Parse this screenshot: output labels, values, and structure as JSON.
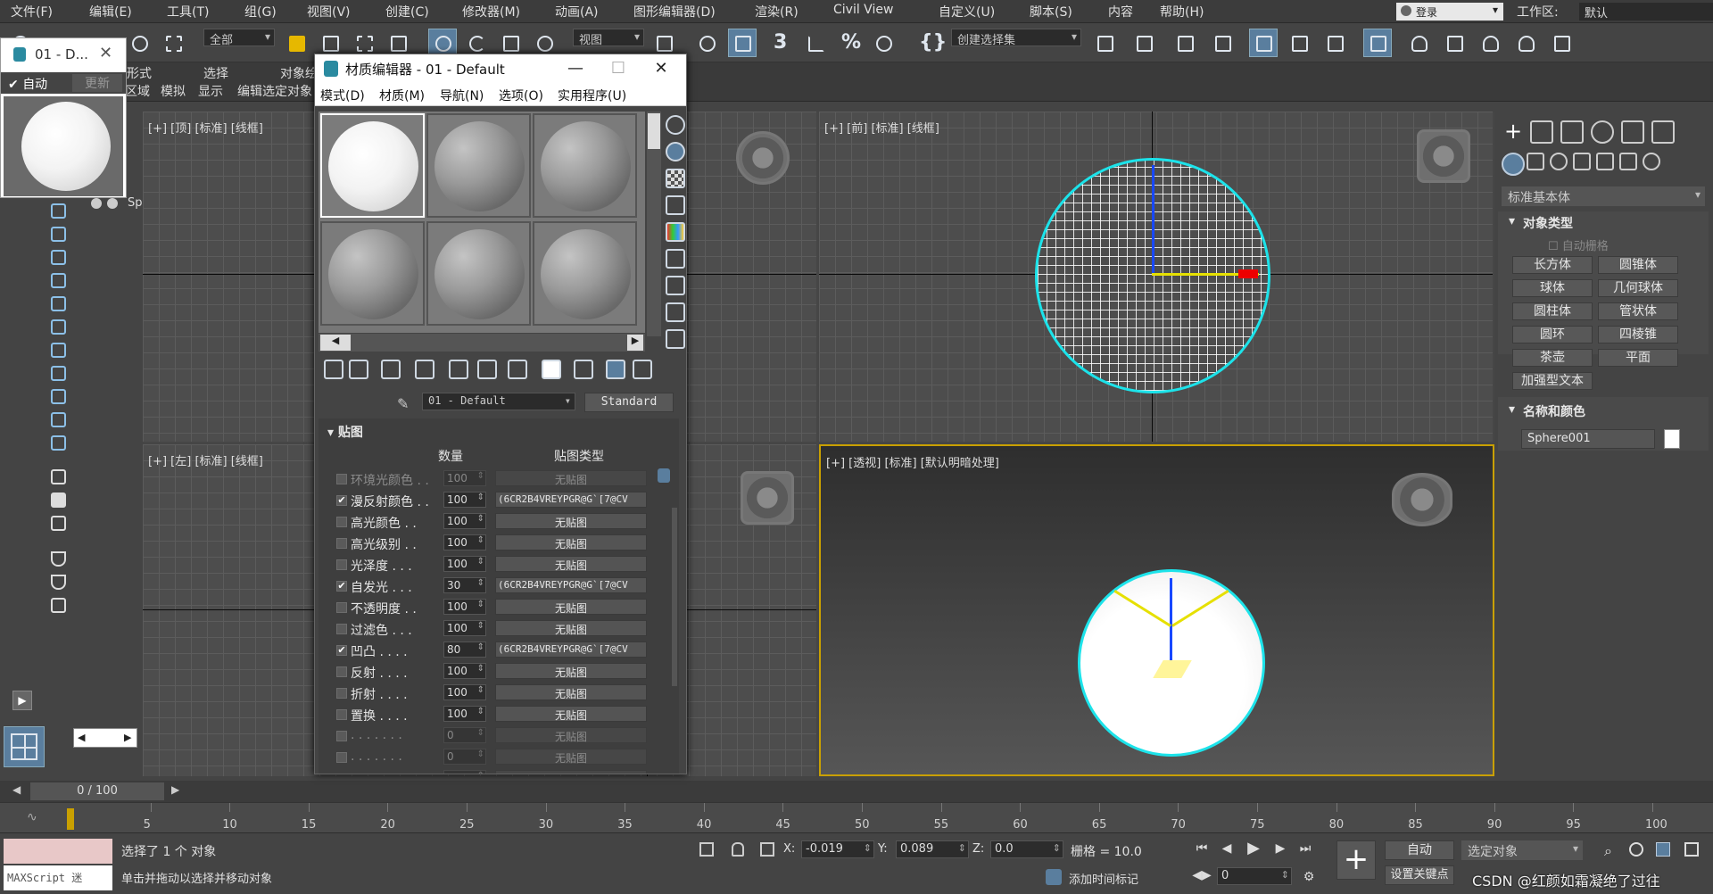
{
  "menubar": {
    "items": [
      "文件(F)",
      "编辑(E)",
      "工具(T)",
      "组(G)",
      "视图(V)",
      "创建(C)",
      "修改器(M)",
      "动画(A)",
      "图形编辑器(D)",
      "渲染(R)",
      "Civil View",
      "自定义(U)",
      "脚本(S)",
      "内容",
      "帮助(H)"
    ],
    "login": "登录",
    "workspace_label": "工作区:",
    "workspace_value": "默认"
  },
  "toolbar": {
    "selection_filter": "全部",
    "ref_coord": "视图",
    "selection_set": "创建选择集"
  },
  "ribbon": {
    "row1": [
      "形式",
      "选择",
      "对象绘"
    ],
    "row2": [
      "区域",
      "模拟",
      "显示",
      "编辑选定对象"
    ]
  },
  "small_window": {
    "title": "01 - D...",
    "auto": "自动",
    "update": "更新"
  },
  "scene_explorer": {
    "partial_text": [
      "Sp"
    ]
  },
  "viewports": {
    "top": "[+] [顶] [标准] [线框]",
    "front": "[+] [前] [标准] [线框]",
    "left": "[+] [左] [标准] [线框]",
    "perspective": "[+] [透视] [标准] [默认明暗处理]"
  },
  "material_editor": {
    "title": "材质编辑器 - 01 - Default",
    "menu": [
      "模式(D)",
      "材质(M)",
      "导航(N)",
      "选项(O)",
      "实用程序(U)"
    ],
    "material_name": "01 - Default",
    "material_type": "Standard",
    "maps_rollout": "贴图",
    "col_amount": "数量",
    "col_map_type": "贴图类型",
    "rows": [
      {
        "name": "环境光颜色 . .",
        "amount": "100",
        "map": "无贴图",
        "checked": false,
        "dim": true
      },
      {
        "name": "漫反射颜色 . .",
        "amount": "100",
        "map": "(6CR2B4VREYPGR@G`[7@CV",
        "checked": true,
        "dim": false
      },
      {
        "name": "高光颜色  . .",
        "amount": "100",
        "map": "无贴图",
        "checked": false,
        "dim": false
      },
      {
        "name": "高光级别  . .",
        "amount": "100",
        "map": "无贴图",
        "checked": false,
        "dim": false
      },
      {
        "name": "光泽度 . . .",
        "amount": "100",
        "map": "无贴图",
        "checked": false,
        "dim": false
      },
      {
        "name": "自发光 . . .",
        "amount": "30",
        "map": "(6CR2B4VREYPGR@G`[7@CV",
        "checked": true,
        "dim": false
      },
      {
        "name": "不透明度  . .",
        "amount": "100",
        "map": "无贴图",
        "checked": false,
        "dim": false
      },
      {
        "name": "过滤色 . . .",
        "amount": "100",
        "map": "无贴图",
        "checked": false,
        "dim": false
      },
      {
        "name": "凹凸  . . . .",
        "amount": "80",
        "map": "(6CR2B4VREYPGR@G`[7@CV",
        "checked": true,
        "dim": false
      },
      {
        "name": "反射  . . . .",
        "amount": "100",
        "map": "无贴图",
        "checked": false,
        "dim": false
      },
      {
        "name": "折射  . . . .",
        "amount": "100",
        "map": "无贴图",
        "checked": false,
        "dim": false
      },
      {
        "name": "置换  . . . .",
        "amount": "100",
        "map": "无贴图",
        "checked": false,
        "dim": false
      },
      {
        "name": ". . . . . . .",
        "amount": "0",
        "map": "无贴图",
        "checked": false,
        "dim": true
      },
      {
        "name": ". . . . . . .",
        "amount": "0",
        "map": "无贴图",
        "checked": false,
        "dim": true
      },
      {
        "name": ". . . . . . .",
        "amount": "0",
        "map": "无贴图",
        "checked": false,
        "dim": true
      }
    ]
  },
  "command_panel": {
    "category": "标准基本体",
    "object_type_title": "对象类型",
    "autogrid": "自动栅格",
    "buttons": [
      "长方体",
      "圆锥体",
      "球体",
      "几何球体",
      "圆柱体",
      "管状体",
      "圆环",
      "四棱锥",
      "茶壶",
      "平面",
      "加强型文本"
    ],
    "name_color_title": "名称和颜色",
    "object_name": "Sphere001"
  },
  "timeline": {
    "frame": "0 / 100",
    "ticks": [
      "5",
      "10",
      "15",
      "20",
      "25",
      "30",
      "35",
      "40",
      "45",
      "50",
      "55",
      "60",
      "65",
      "70",
      "75",
      "80",
      "85",
      "90",
      "95",
      "100"
    ]
  },
  "statusbar": {
    "maxscript": "MAXScript 迷",
    "selected": "选择了 1 个 对象",
    "hint": "单击并拖动以选择并移动对象",
    "x_label": "X:",
    "x_value": "-0.019",
    "y_label": "Y:",
    "y_value": "0.089",
    "z_label": "Z:",
    "z_value": "0.0",
    "grid": "栅格 = 10.0",
    "add_time_tag": "添加时间标记",
    "auto": "自动",
    "set_key": "设置关键点",
    "selected_objects": "选定对象",
    "frame_field": "0",
    "watermark": "CSDN @红颜如霜凝绝了过往"
  },
  "colors": {
    "selection_cyan": "#1ce3ea",
    "active_viewport": "#c9a000",
    "accent": "#5a7e9e"
  }
}
